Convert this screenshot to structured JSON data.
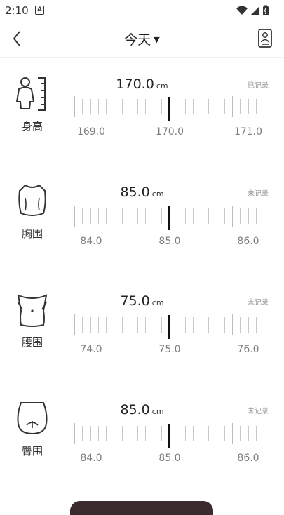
{
  "status_bar": {
    "time": "2:10",
    "app_icon": "A"
  },
  "header": {
    "title": "今天",
    "caret": "▼"
  },
  "sections": [
    {
      "label": "身高",
      "value": "170.0",
      "unit": "cm",
      "status": "已记录",
      "ticks": [
        "169.0",
        "170.0",
        "171.0"
      ],
      "icon": "height-icon"
    },
    {
      "label": "胸围",
      "value": "85.0",
      "unit": "cm",
      "status": "未记录",
      "ticks": [
        "84.0",
        "85.0",
        "86.0"
      ],
      "icon": "chest-icon"
    },
    {
      "label": "腰围",
      "value": "75.0",
      "unit": "cm",
      "status": "未记录",
      "ticks": [
        "74.0",
        "75.0",
        "76.0"
      ],
      "icon": "waist-icon"
    },
    {
      "label": "臀围",
      "value": "85.0",
      "unit": "cm",
      "status": "未记录",
      "ticks": [
        "84.0",
        "85.0",
        "86.0"
      ],
      "icon": "hip-icon"
    }
  ],
  "colors": {
    "accent": "#3a2b2f",
    "tick": "#c9c9c9",
    "pointer": "#111111"
  }
}
